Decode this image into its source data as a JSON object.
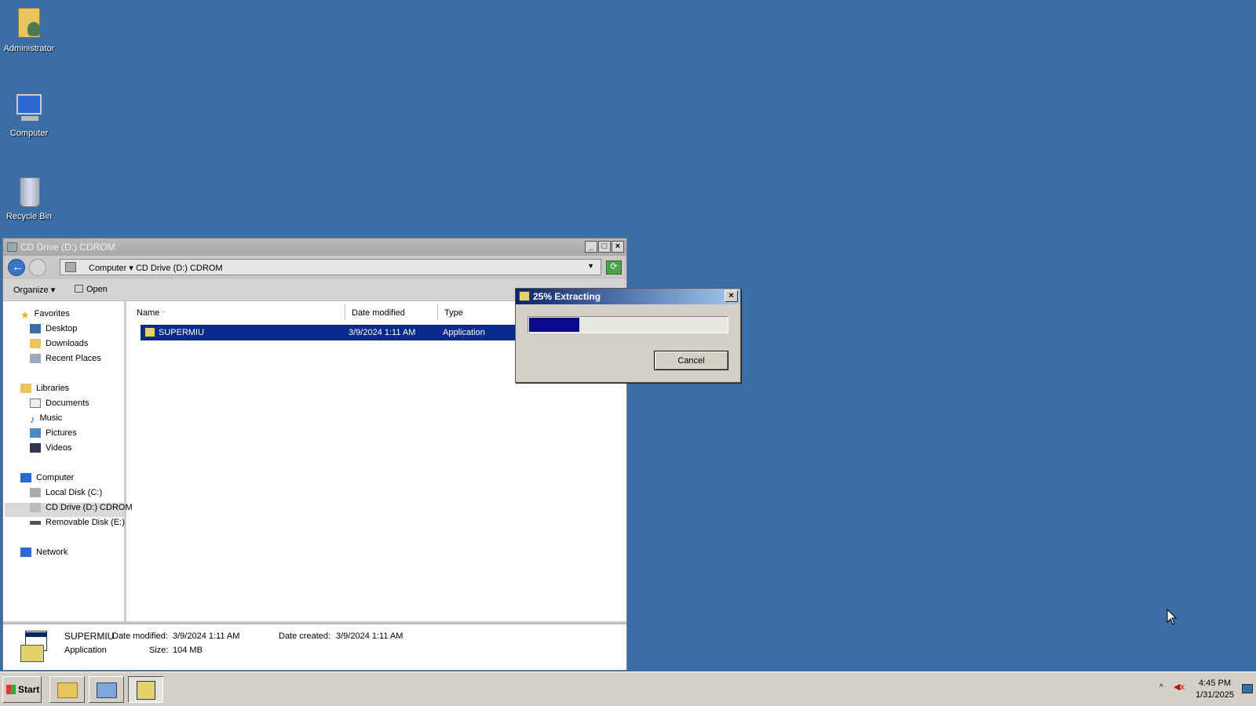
{
  "desktop": {
    "icons": [
      {
        "label": "Administrator",
        "icon": "user-folder-icon"
      },
      {
        "label": "Computer",
        "icon": "computer-icon"
      },
      {
        "label": "Recycle Bin",
        "icon": "recycle-bin-icon"
      }
    ]
  },
  "explorer": {
    "title": "CD Drive (D:) CDROM",
    "address": {
      "crumb1": "Computer",
      "crumb2": "CD Drive (D:) CDROM"
    },
    "toolbar": {
      "organize": "Organize",
      "open": "Open"
    },
    "nav": {
      "favorites": "Favorites",
      "desktop": "Desktop",
      "downloads": "Downloads",
      "recent_places": "Recent Places",
      "libraries": "Libraries",
      "documents": "Documents",
      "music": "Music",
      "pictures": "Pictures",
      "videos": "Videos",
      "computer": "Computer",
      "local_disk": "Local Disk (C:)",
      "cd_drive": "CD Drive (D:) CDROM",
      "removable": "Removable Disk (E:)",
      "network": "Network"
    },
    "columns": {
      "name": "Name",
      "date_modified": "Date modified",
      "type": "Type"
    },
    "files": [
      {
        "name": "SUPERMIU",
        "date_modified": "3/9/2024 1:11 AM",
        "type": "Application"
      }
    ],
    "details": {
      "name": "SUPERMIU",
      "date_modified_label": "Date modified:",
      "date_modified": "3/9/2024 1:11 AM",
      "date_created_label": "Date created:",
      "date_created": "3/9/2024 1:11 AM",
      "type": "Application",
      "size_label": "Size:",
      "size": "104 MB"
    }
  },
  "dialog": {
    "title": "25% Extracting",
    "progress_fraction": 0.25,
    "cancel_label": "Cancel"
  },
  "taskbar": {
    "start_label": "Start",
    "time": "4:45 PM",
    "date": "1/31/2025"
  },
  "colors": {
    "desktop": "#3a6ea5",
    "selection": "#0a2a8c",
    "progress": "#0a0a8c"
  }
}
